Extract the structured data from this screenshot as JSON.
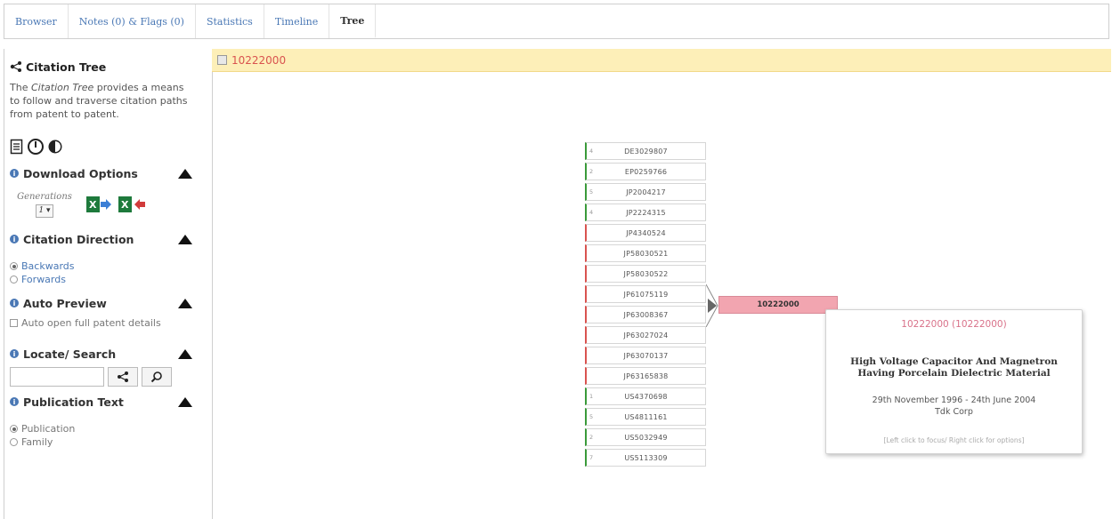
{
  "tabs": [
    {
      "label": "Browser",
      "active": false
    },
    {
      "label": "Notes (0) & Flags (0)",
      "active": false
    },
    {
      "label": "Statistics",
      "active": false
    },
    {
      "label": "Timeline",
      "active": false
    },
    {
      "label": "Tree",
      "active": true
    }
  ],
  "sidebar": {
    "title": "Citation Tree",
    "desc_part1": "The ",
    "desc_italic": "Citation Tree",
    "desc_part2": " provides a means to follow and traverse citation paths from patent to patent.",
    "icons": [
      "document-icon",
      "power-icon",
      "contrast-icon"
    ],
    "download": {
      "heading": "Download Options",
      "generations_label": "Generations",
      "generations_value": "1 ▾",
      "export_icons": [
        "excel-export-icon",
        "excel-import-icon"
      ]
    },
    "direction": {
      "heading": "Citation Direction",
      "options": [
        {
          "label": "Backwards",
          "selected": true
        },
        {
          "label": "Forwards",
          "selected": false
        }
      ]
    },
    "auto_preview": {
      "heading": "Auto Preview",
      "checkbox_label": "Auto open full patent details"
    },
    "locate": {
      "heading": "Locate/ Search"
    },
    "publication_text": {
      "heading": "Publication Text",
      "options": [
        {
          "label": "Publication",
          "selected": true
        },
        {
          "label": "Family",
          "selected": false
        }
      ]
    }
  },
  "main": {
    "header_title": "10222000",
    "nodes": [
      {
        "level": "4",
        "number": "DE3029807",
        "color": "green"
      },
      {
        "level": "2",
        "number": "EP0259766",
        "color": "green"
      },
      {
        "level": "5",
        "number": "JP2004217",
        "color": "green"
      },
      {
        "level": "4",
        "number": "JP2224315",
        "color": "green"
      },
      {
        "level": "",
        "number": "JP4340524",
        "color": "red"
      },
      {
        "level": "",
        "number": "JP58030521",
        "color": "red"
      },
      {
        "level": "",
        "number": "JP58030522",
        "color": "red"
      },
      {
        "level": "",
        "number": "JP61075119",
        "color": "red"
      },
      {
        "level": "",
        "number": "JP63008367",
        "color": "red"
      },
      {
        "level": "",
        "number": "JP63027024",
        "color": "red"
      },
      {
        "level": "",
        "number": "JP63070137",
        "color": "red"
      },
      {
        "level": "",
        "number": "JP63165838",
        "color": "red"
      },
      {
        "level": "1",
        "number": "US4370698",
        "color": "green"
      },
      {
        "level": "5",
        "number": "US4811161",
        "color": "green"
      },
      {
        "level": "2",
        "number": "US5032949",
        "color": "green"
      },
      {
        "level": "7",
        "number": "US5113309",
        "color": "green"
      }
    ],
    "root": "10222000",
    "tooltip": {
      "heading": "10222000 (10222000)",
      "title_line1": "High Voltage Capacitor And Magnetron",
      "title_line2": "Having Porcelain Dielectric Material",
      "dates": "29th November 1996 - 24th June 2004",
      "assignee": "Tdk Corp",
      "hint": "[Left click to focus/ Right click for options]"
    }
  }
}
